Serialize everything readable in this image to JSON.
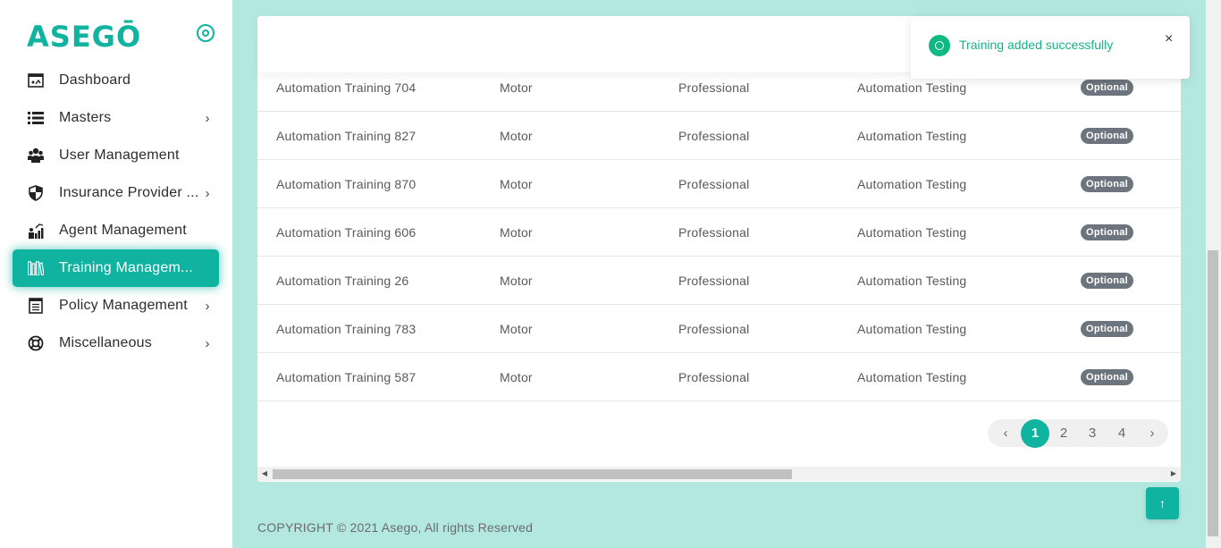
{
  "brand": {
    "logo_text": "ASEGŌ",
    "accent_color": "#10b2a0"
  },
  "sidebar": {
    "items": [
      {
        "label": "Dashboard",
        "icon": "dashboard-icon",
        "has_submenu": false,
        "active": false
      },
      {
        "label": "Masters",
        "icon": "list-icon",
        "has_submenu": true,
        "active": false
      },
      {
        "label": "User Management",
        "icon": "users-icon",
        "has_submenu": false,
        "active": false
      },
      {
        "label": "Insurance Provider ...",
        "icon": "shield-icon",
        "has_submenu": true,
        "active": false
      },
      {
        "label": "Agent Management",
        "icon": "agent-icon",
        "has_submenu": false,
        "active": false
      },
      {
        "label": "Training Managem...",
        "icon": "books-icon",
        "has_submenu": false,
        "active": true
      },
      {
        "label": "Policy Management",
        "icon": "policy-document-icon",
        "has_submenu": true,
        "active": false
      },
      {
        "label": "Miscellaneous",
        "icon": "lifebuoy-icon",
        "has_submenu": true,
        "active": false
      }
    ]
  },
  "table": {
    "rows": [
      {
        "name": "Automation Training 704",
        "category": "Motor",
        "level": "Professional",
        "group": "Automation Testing",
        "status": "Optional"
      },
      {
        "name": "Automation Training 827",
        "category": "Motor",
        "level": "Professional",
        "group": "Automation Testing",
        "status": "Optional"
      },
      {
        "name": "Automation Training 870",
        "category": "Motor",
        "level": "Professional",
        "group": "Automation Testing",
        "status": "Optional"
      },
      {
        "name": "Automation Training 606",
        "category": "Motor",
        "level": "Professional",
        "group": "Automation Testing",
        "status": "Optional"
      },
      {
        "name": "Automation Training 26",
        "category": "Motor",
        "level": "Professional",
        "group": "Automation Testing",
        "status": "Optional"
      },
      {
        "name": "Automation Training 783",
        "category": "Motor",
        "level": "Professional",
        "group": "Automation Testing",
        "status": "Optional"
      },
      {
        "name": "Automation Training 587",
        "category": "Motor",
        "level": "Professional",
        "group": "Automation Testing",
        "status": "Optional"
      }
    ]
  },
  "pagination": {
    "prev": "‹",
    "next": "›",
    "pages": [
      "1",
      "2",
      "3",
      "4"
    ],
    "current": "1"
  },
  "toast": {
    "message": "Training added successfully",
    "close": "×",
    "type": "success"
  },
  "back_to_top": "↑",
  "footer": {
    "copyright": "COPYRIGHT © 2021 Asego, All rights Reserved"
  }
}
